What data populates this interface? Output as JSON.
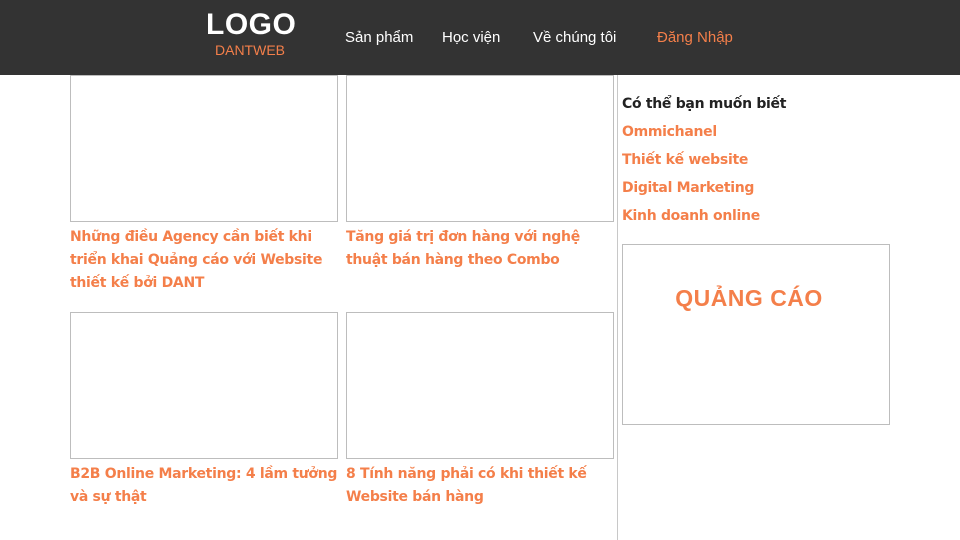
{
  "header": {
    "logo_title": "LOGO",
    "logo_subtitle": "DANTWEB",
    "nav": [
      {
        "label": "Sản phẩm"
      },
      {
        "label": "Học viện"
      },
      {
        "label": "Về chúng tôi"
      },
      {
        "label": "Đăng Nhập"
      }
    ]
  },
  "articles": [
    {
      "title": "Những điều Agency cần biết khi triển khai Quảng cáo với Website thiết kế bởi DANT"
    },
    {
      "title": "Tăng giá trị đơn hàng với nghệ thuật bán hàng theo Combo"
    },
    {
      "title": "B2B Online Marketing: 4 lầm tưởng và sự thật"
    },
    {
      "title": "8 Tính năng phải có khi thiết kế Website bán hàng"
    }
  ],
  "sidebar": {
    "heading": "Có thể bạn muốn biết",
    "links": [
      {
        "label": "Ommichanel"
      },
      {
        "label": "Thiết kế website"
      },
      {
        "label": "Digital Marketing"
      },
      {
        "label": "Kinh doanh online"
      }
    ],
    "ad_label": "QUẢNG CÁO"
  },
  "colors": {
    "header_bg": "#333333",
    "accent": "#f47f4a",
    "border": "#bdbdbd"
  }
}
